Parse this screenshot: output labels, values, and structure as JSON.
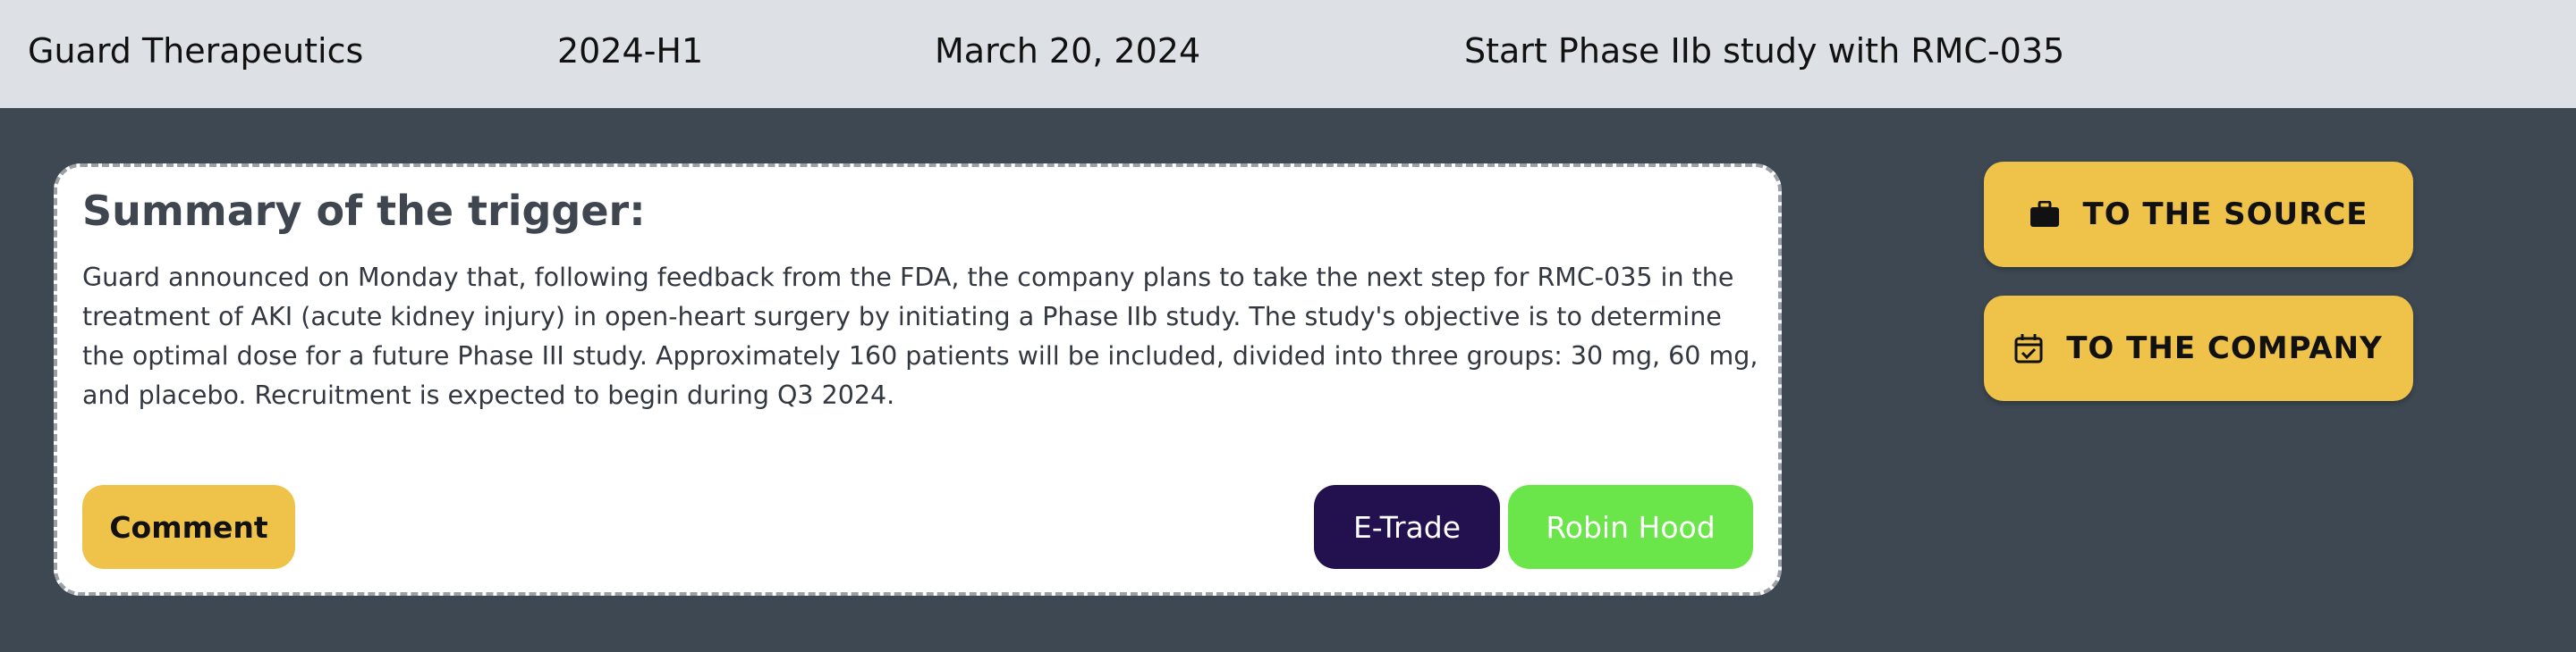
{
  "header": {
    "company": "Guard Therapeutics",
    "period": "2024-H1",
    "date": "March 20, 2024",
    "title": "Start Phase IIb study with RMC-035"
  },
  "card": {
    "title": "Summary of the trigger:",
    "body": "Guard announced on Monday that, following feedback from the FDA, the company plans to take the next step for RMC-035 in the treatment of AKI (acute kidney injury) in open-heart surgery by initiating a Phase IIb study. The study's objective is to determine the optimal dose for a future Phase III study. Approximately 160 patients will be included, divided into three groups: 30 mg, 60 mg, and placebo. Recruitment is expected to begin during Q3 2024.",
    "comment_label": "Comment",
    "etrade_label": "E-Trade",
    "robinhood_label": "Robin Hood"
  },
  "side": {
    "source_label": "TO THE SOURCE",
    "source_icon": "briefcase-icon",
    "company_label": "TO THE COMPANY",
    "company_icon": "calendar-check-icon"
  },
  "colors": {
    "header_bg": "#dde0e4",
    "page_bg": "#3e4852",
    "accent_yellow": "#efc24a",
    "etrade_purple": "#22104f",
    "robinhood_green": "#6be64a"
  }
}
